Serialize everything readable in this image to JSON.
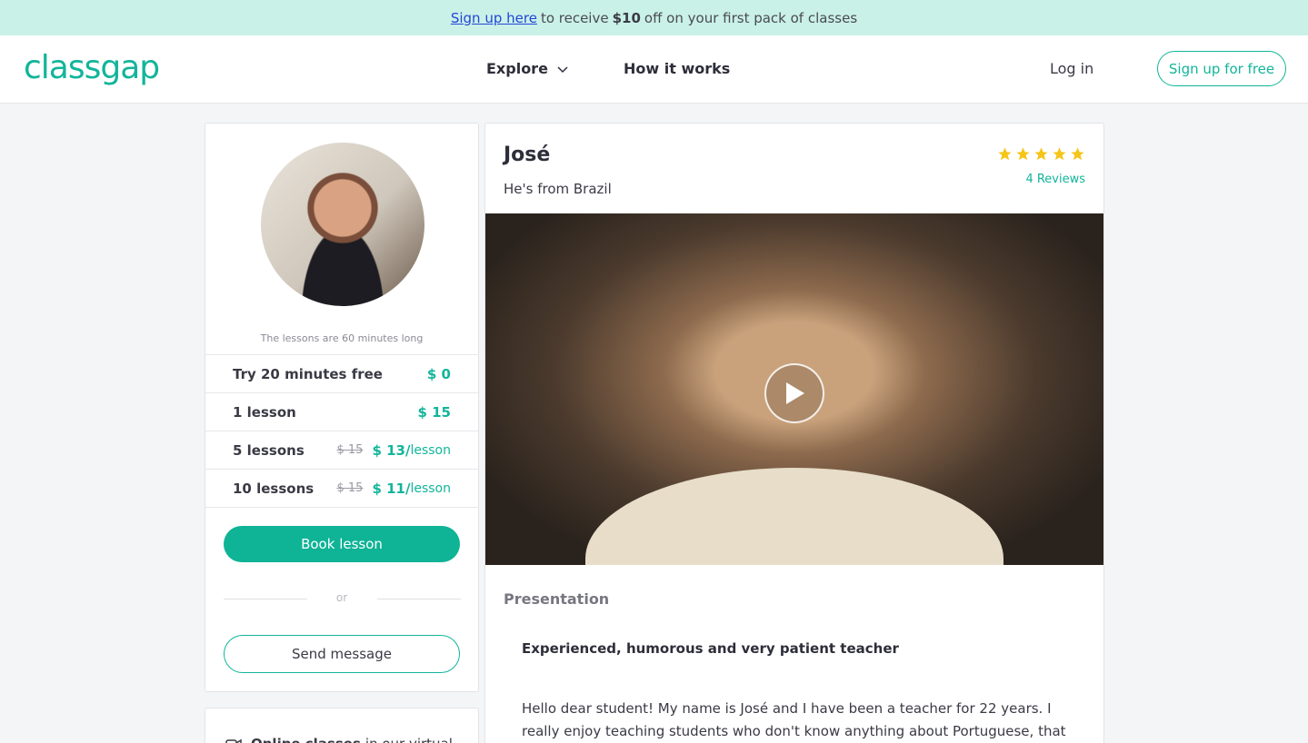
{
  "promo": {
    "link": "Sign up here",
    "pre": "to receive",
    "amount": "$10",
    "post": "off on your first pack of classes"
  },
  "header": {
    "logo": "classgap",
    "explore": "Explore",
    "how": "How it works",
    "login": "Log in",
    "signup": "Sign up for free"
  },
  "teacher": {
    "name": "José",
    "origin": "He's from Brazil",
    "rating": 5,
    "reviews": "4 Reviews"
  },
  "pricing": {
    "note": "The lessons are 60 minutes long",
    "rows": [
      {
        "label": "Try 20 minutes free",
        "old": "",
        "price": "$ 0",
        "unit": ""
      },
      {
        "label": "1 lesson",
        "old": "",
        "price": "$ 15",
        "unit": ""
      },
      {
        "label": "5 lessons",
        "old": "$ 15",
        "price": "$ 13/",
        "unit": "lesson"
      },
      {
        "label": "10 lessons",
        "old": "$ 15",
        "price": "$ 11/",
        "unit": "lesson"
      }
    ],
    "book": "Book lesson",
    "or": "or",
    "message": "Send message"
  },
  "online": {
    "bold": "Online classes",
    "rest": "in our virtual"
  },
  "presentation": {
    "heading": "Presentation",
    "headline": "Experienced, humorous and very patient teacher",
    "body": "Hello dear student! My name is José and I have been a teacher for 22 years. I really enjoy teaching students who don't know anything about Portuguese, that is, I like to"
  },
  "colors": {
    "accent": "#12b59a",
    "star": "#f5c518",
    "banner": "#c9f1e7"
  }
}
